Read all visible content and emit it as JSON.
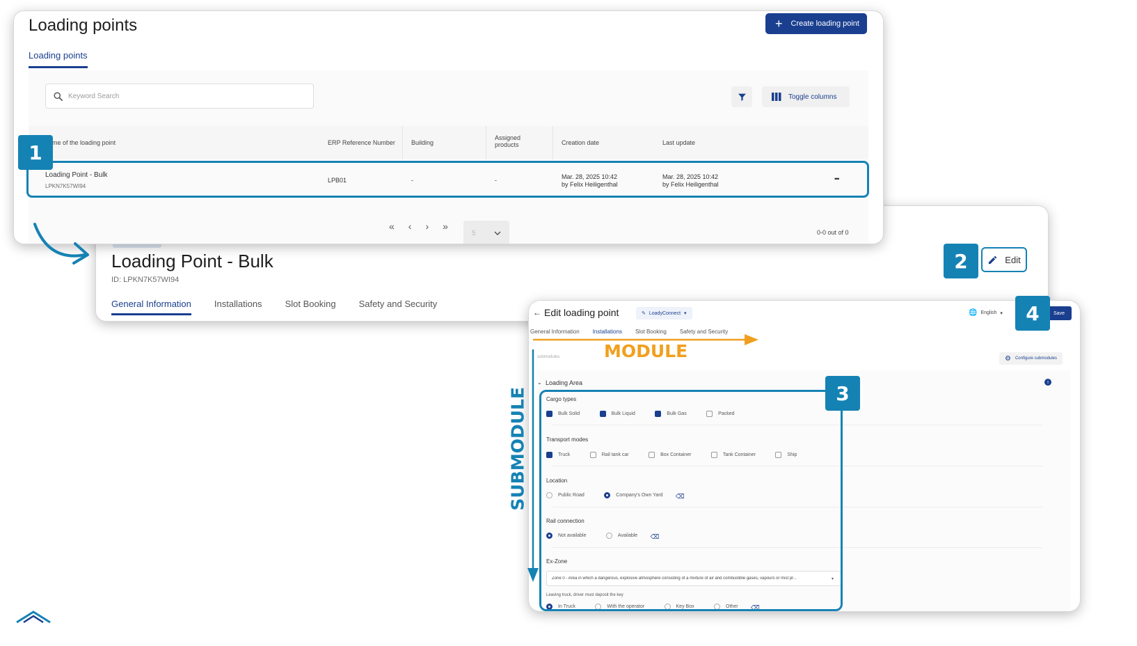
{
  "list": {
    "title": "Loading points",
    "create_button": "Create loading point",
    "tab": "Loading points",
    "search_placeholder": "Keyword Search",
    "toggle_columns": "Toggle columns",
    "columns": [
      "me of the loading point",
      "ERP Reference Number",
      "Building",
      "Assigned products",
      "Creation date",
      "Last update"
    ],
    "row": {
      "name": "Loading Point - Bulk",
      "id": "LPKN7K57WI94",
      "erp": "LPB01",
      "building": "-",
      "products": "-",
      "created_date": "Mar. 28, 2025 10:42",
      "created_by": "by Felix Heiligenthal",
      "updated_date": "Mar. 28, 2025 10:42",
      "updated_by": "by Felix Heiligenthal",
      "more": "•••"
    },
    "pagination": {
      "first": "«",
      "prev": "‹",
      "next": "›",
      "last": "»",
      "page_size": "5",
      "count": "0-0 out of 0"
    }
  },
  "detail": {
    "title": "Loading Point - Bulk",
    "id_label": "ID: LPKN7K57WI94",
    "edit": "Edit",
    "tabs": [
      "General Information",
      "Installations",
      "Slot Booking",
      "Safety and Security"
    ]
  },
  "edit": {
    "back": "←",
    "title": "Edit loading point",
    "app": "LoadyConnect",
    "language": "English",
    "save": "Save",
    "tabs": [
      "General Information",
      "Installations",
      "Slot Booking",
      "Safety and Security"
    ],
    "submodules_count": "submodules",
    "configure": "Configure submodules",
    "section": "Loading Area",
    "cargo_title": "Cargo types",
    "cargo": [
      "Bulk Solid",
      "Bulk Liquid",
      "Bulk Gas",
      "Packed"
    ],
    "transport_title": "Transport modes",
    "transport": [
      "Truck",
      "Rail tank car",
      "Box Container",
      "Tank Container",
      "Ship"
    ],
    "location_title": "Location",
    "location": [
      "Public Road",
      "Company's Own Yard"
    ],
    "rail_title": "Rail connection",
    "rail": [
      "Not available",
      "Available"
    ],
    "exzone_title": "Ex-Zone",
    "exzone_value": "Zone 0 - Area in which a dangerous, explosive atmosphere consisting of a mixture of air and combustible gases, vapours or mist pr...",
    "key_title": "Leaving truck, driver must deposit the key",
    "key": [
      "In Truck",
      "With the operator",
      "Key Box",
      "Other"
    ]
  },
  "annotations": {
    "badge1": "1",
    "badge2": "2",
    "badge3": "3",
    "badge4": "4",
    "module": "MODULE",
    "submodule": "SUBMODULE"
  },
  "colors": {
    "primary": "#1a3f8f",
    "annotation_blue": "#1582b4",
    "annotation_orange": "#f0a020"
  }
}
